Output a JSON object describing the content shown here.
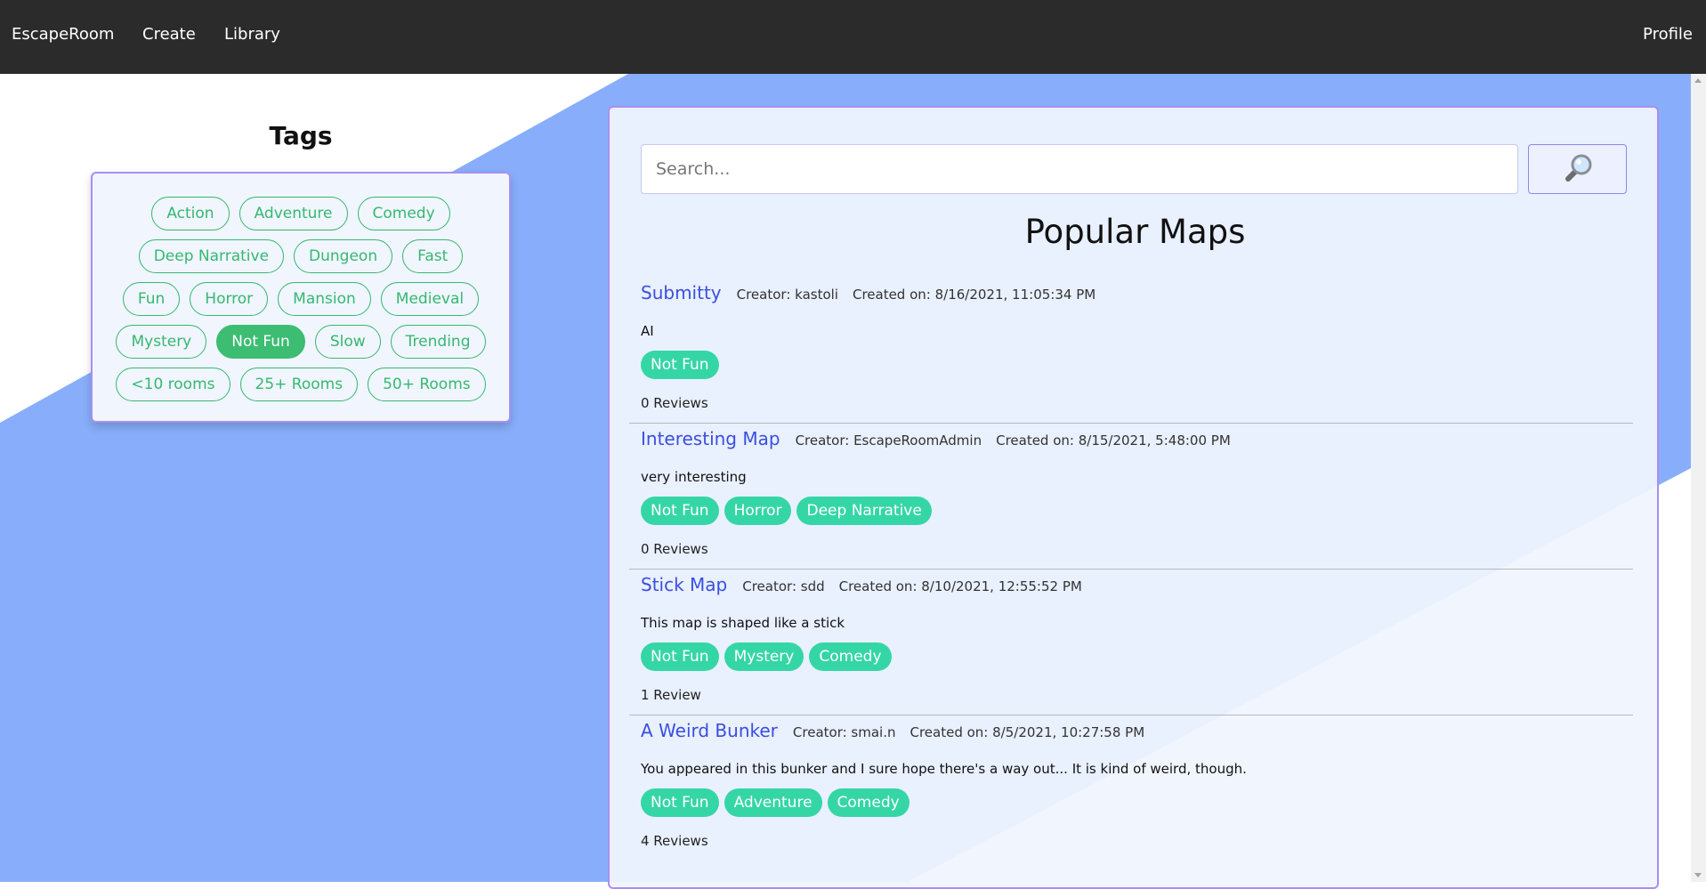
{
  "colors": {
    "navbar": "#2b2b2b",
    "background_blue": "#88aefb",
    "panel_background": "#f0f5fe",
    "accent_border": "#a98ff0",
    "tag_outline_green": "#36b870",
    "tag_active_green": "#3cbd72",
    "map_tag_teal": "#35d6a5",
    "map_title_blue": "#3a4fde"
  },
  "navbar": {
    "brand": "EscapeRoom",
    "links": [
      "Create",
      "Library"
    ],
    "profile": "Profile"
  },
  "tags_panel": {
    "title": "Tags",
    "rows": [
      [
        {
          "label": "Action",
          "active": false
        },
        {
          "label": "Adventure",
          "active": false
        },
        {
          "label": "Comedy",
          "active": false
        }
      ],
      [
        {
          "label": "Deep Narrative",
          "active": false
        },
        {
          "label": "Dungeon",
          "active": false
        },
        {
          "label": "Fast",
          "active": false
        }
      ],
      [
        {
          "label": "Fun",
          "active": false
        },
        {
          "label": "Horror",
          "active": false
        },
        {
          "label": "Mansion",
          "active": false
        },
        {
          "label": "Medieval",
          "active": false
        }
      ],
      [
        {
          "label": "Mystery",
          "active": false
        },
        {
          "label": "Not Fun",
          "active": true
        },
        {
          "label": "Slow",
          "active": false
        },
        {
          "label": "Trending",
          "active": false
        }
      ],
      [
        {
          "label": "<10 rooms",
          "active": false
        },
        {
          "label": "25+ Rooms",
          "active": false
        },
        {
          "label": "50+ Rooms",
          "active": false
        }
      ]
    ]
  },
  "search": {
    "placeholder": "Search...",
    "value": "",
    "button_icon": "magnifying-glass-icon"
  },
  "main": {
    "title": "Popular Maps",
    "maps": [
      {
        "title": "Submitty",
        "creator": "Creator: kastoli",
        "created": "Created on: 8/16/2021, 11:05:34 PM",
        "description": "AI",
        "tags": [
          "Not Fun"
        ],
        "reviews": "0 Reviews"
      },
      {
        "title": "Interesting Map",
        "creator": "Creator: EscapeRoomAdmin",
        "created": "Created on: 8/15/2021, 5:48:00 PM",
        "description": "very interesting",
        "tags": [
          "Not Fun",
          "Horror",
          "Deep Narrative"
        ],
        "reviews": "0 Reviews"
      },
      {
        "title": "Stick Map",
        "creator": "Creator: sdd",
        "created": "Created on: 8/10/2021, 12:55:52 PM",
        "description": "This map is shaped like a stick",
        "tags": [
          "Not Fun",
          "Mystery",
          "Comedy"
        ],
        "reviews": "1 Review"
      },
      {
        "title": "A Weird Bunker",
        "creator": "Creator: smai.n",
        "created": "Created on: 8/5/2021, 10:27:58 PM",
        "description": "You appeared in this bunker and I sure hope there's a way out... It is kind of weird, though.",
        "tags": [
          "Not Fun",
          "Adventure",
          "Comedy"
        ],
        "reviews": "4 Reviews"
      }
    ]
  }
}
